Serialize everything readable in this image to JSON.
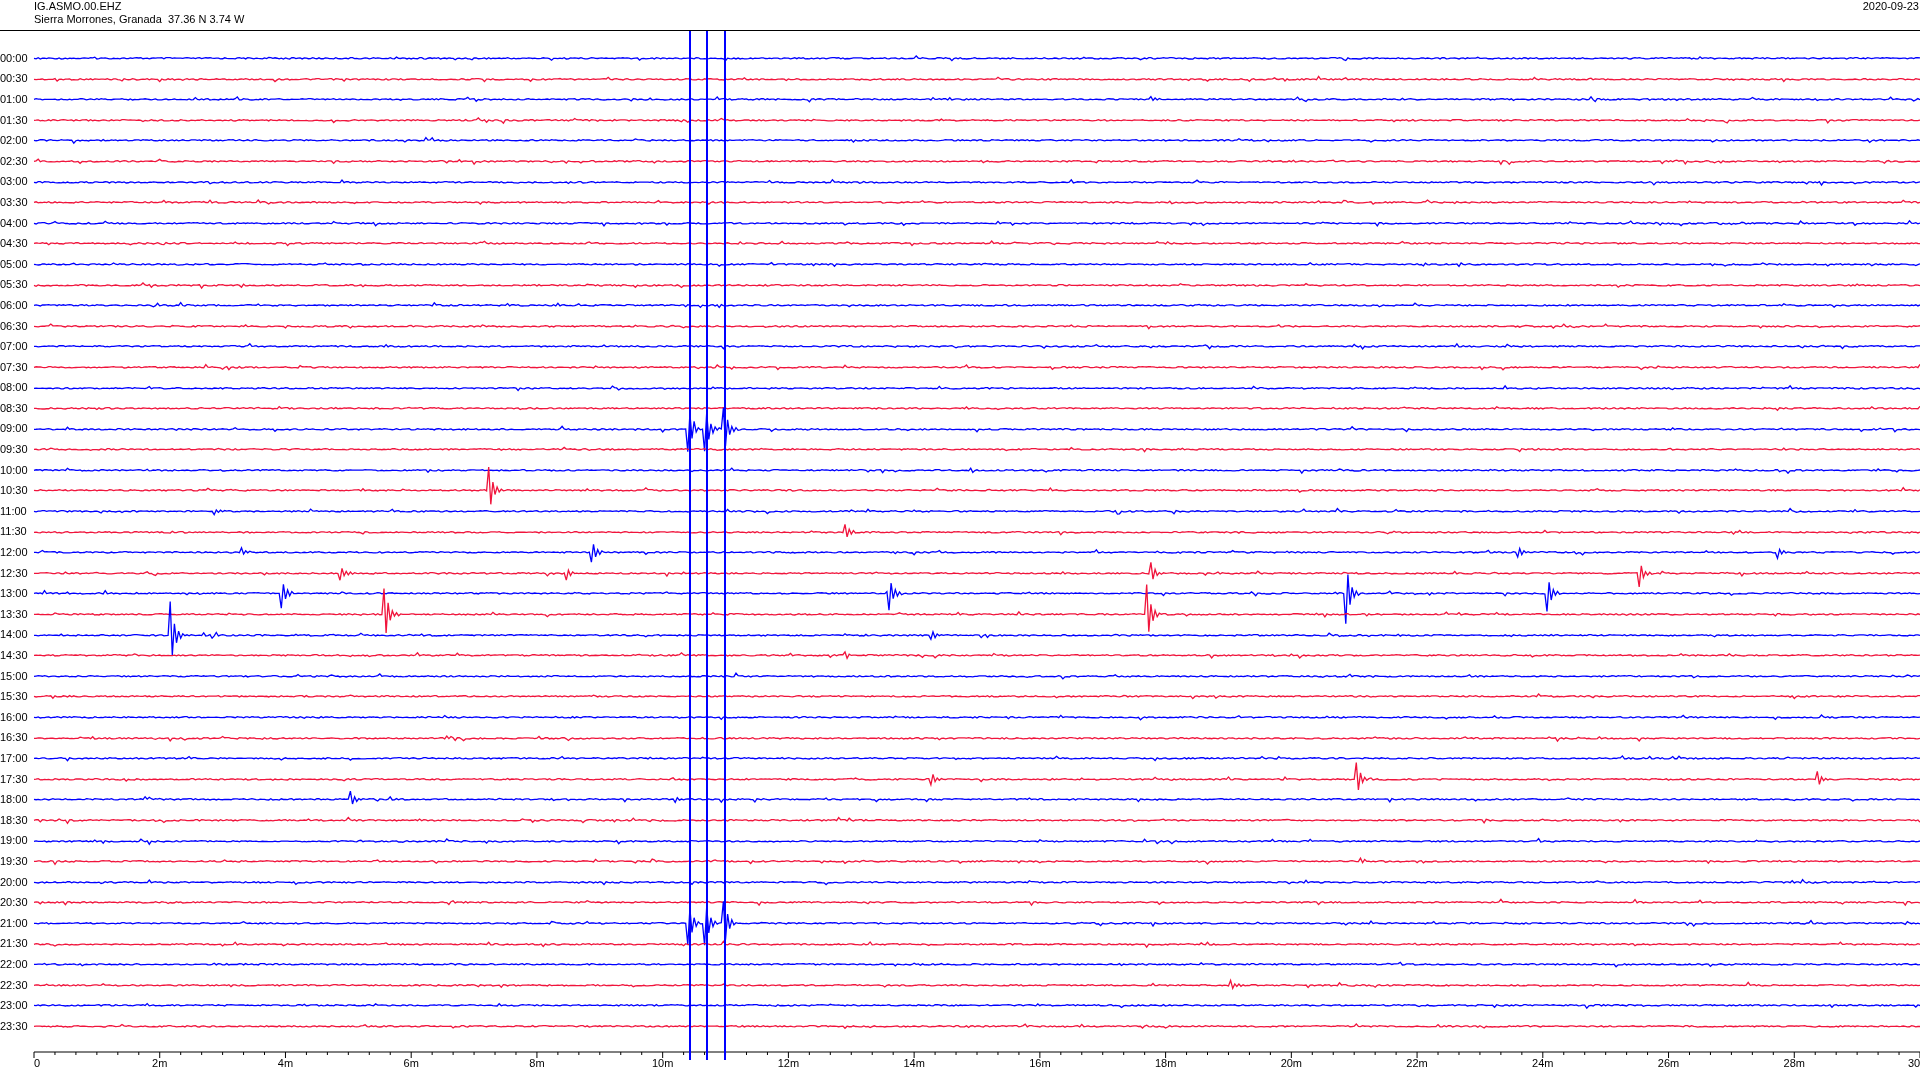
{
  "header": {
    "station": "IG.ASMO.00.EHZ",
    "location": "Sierra Morrones, Granada  37.36 N 3.74 W",
    "date": "2020-09-23"
  },
  "rows": [
    {
      "label": "00:00",
      "color": "#0000ff"
    },
    {
      "label": "00:30",
      "color": "#f0143c"
    },
    {
      "label": "01:00",
      "color": "#0000ff"
    },
    {
      "label": "01:30",
      "color": "#f0143c"
    },
    {
      "label": "02:00",
      "color": "#0000ff"
    },
    {
      "label": "02:30",
      "color": "#f0143c"
    },
    {
      "label": "03:00",
      "color": "#0000ff"
    },
    {
      "label": "03:30",
      "color": "#f0143c"
    },
    {
      "label": "04:00",
      "color": "#0000ff"
    },
    {
      "label": "04:30",
      "color": "#f0143c"
    },
    {
      "label": "05:00",
      "color": "#0000ff"
    },
    {
      "label": "05:30",
      "color": "#f0143c"
    },
    {
      "label": "06:00",
      "color": "#0000ff"
    },
    {
      "label": "06:30",
      "color": "#f0143c"
    },
    {
      "label": "07:00",
      "color": "#0000ff"
    },
    {
      "label": "07:30",
      "color": "#f0143c"
    },
    {
      "label": "08:00",
      "color": "#0000ff"
    },
    {
      "label": "08:30",
      "color": "#f0143c"
    },
    {
      "label": "09:00",
      "color": "#0000ff"
    },
    {
      "label": "09:30",
      "color": "#f0143c"
    },
    {
      "label": "10:00",
      "color": "#0000ff"
    },
    {
      "label": "10:30",
      "color": "#f0143c"
    },
    {
      "label": "11:00",
      "color": "#0000ff"
    },
    {
      "label": "11:30",
      "color": "#f0143c"
    },
    {
      "label": "12:00",
      "color": "#0000ff"
    },
    {
      "label": "12:30",
      "color": "#f0143c"
    },
    {
      "label": "13:00",
      "color": "#0000ff"
    },
    {
      "label": "13:30",
      "color": "#f0143c"
    },
    {
      "label": "14:00",
      "color": "#0000ff"
    },
    {
      "label": "14:30",
      "color": "#f0143c"
    },
    {
      "label": "15:00",
      "color": "#0000ff"
    },
    {
      "label": "15:30",
      "color": "#f0143c"
    },
    {
      "label": "16:00",
      "color": "#0000ff"
    },
    {
      "label": "16:30",
      "color": "#f0143c"
    },
    {
      "label": "17:00",
      "color": "#0000ff"
    },
    {
      "label": "17:30",
      "color": "#f0143c"
    },
    {
      "label": "18:00",
      "color": "#0000ff"
    },
    {
      "label": "18:30",
      "color": "#f0143c"
    },
    {
      "label": "19:00",
      "color": "#0000ff"
    },
    {
      "label": "19:30",
      "color": "#f0143c"
    },
    {
      "label": "20:00",
      "color": "#0000ff"
    },
    {
      "label": "20:30",
      "color": "#f0143c"
    },
    {
      "label": "21:00",
      "color": "#0000ff"
    },
    {
      "label": "21:30",
      "color": "#f0143c"
    },
    {
      "label": "22:00",
      "color": "#0000ff"
    },
    {
      "label": "22:30",
      "color": "#f0143c"
    },
    {
      "label": "23:00",
      "color": "#0000ff"
    },
    {
      "label": "23:30",
      "color": "#f0143c"
    }
  ],
  "axis": {
    "tick_labels": [
      "0",
      "2m",
      "4m",
      "6m",
      "8m",
      "10m",
      "12m",
      "14m",
      "16m",
      "18m",
      "20m",
      "22m",
      "24m",
      "26m",
      "28m",
      "30"
    ]
  }
}
